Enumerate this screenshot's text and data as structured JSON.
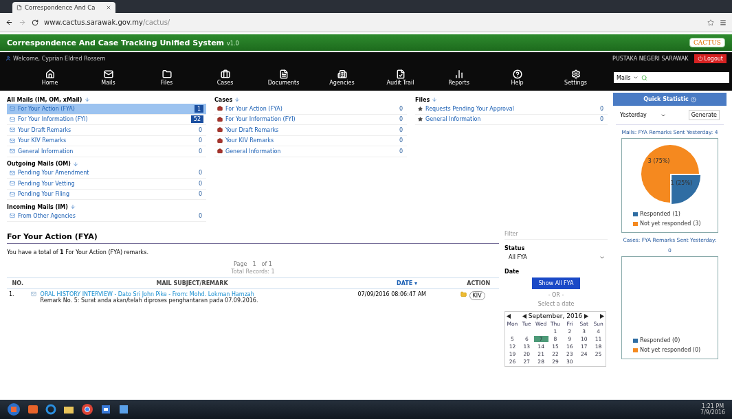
{
  "browser": {
    "tab_title": "Correspondence And Ca",
    "url_host": "www.cactus.sarawak.gov.my",
    "url_path": "/cactus/"
  },
  "header": {
    "title": "Correspondence And Case Tracking Unified System",
    "version": "v1.0",
    "logo": "CACTUS"
  },
  "userbar": {
    "welcome": "Welcome, Cyprian Eldred Rossem",
    "organization": "PUSTAKA NEGERI SARAWAK",
    "logout": "Logout"
  },
  "nav": [
    {
      "label": "Home"
    },
    {
      "label": "Mails"
    },
    {
      "label": "Files"
    },
    {
      "label": "Cases"
    },
    {
      "label": "Documents"
    },
    {
      "label": "Agencies"
    },
    {
      "label": "Audit Trail"
    },
    {
      "label": "Reports"
    },
    {
      "label": "Help"
    },
    {
      "label": "Settings"
    }
  ],
  "search": {
    "scope": "Mails"
  },
  "columns": [
    {
      "kind": "mail",
      "sections": [
        {
          "title": "All Mails (IM, OM, xMail)",
          "items": [
            {
              "label": "For Your Action (FYA)",
              "count": "1",
              "selected": true,
              "badge": true
            },
            {
              "label": "For Your Information (FYI)",
              "count": "52",
              "selected": false,
              "badge": true
            },
            {
              "label": "Your Draft Remarks",
              "count": "0",
              "selected": false,
              "badge": false
            },
            {
              "label": "Your KIV Remarks",
              "count": "0",
              "selected": false,
              "badge": false
            },
            {
              "label": "General Information",
              "count": "0",
              "selected": false,
              "badge": false
            }
          ]
        },
        {
          "title": "Outgoing Mails (OM)",
          "items": [
            {
              "label": "Pending Your Amendment",
              "count": "0",
              "selected": false,
              "badge": false
            },
            {
              "label": "Pending Your Vetting",
              "count": "0",
              "selected": false,
              "badge": false
            },
            {
              "label": "Pending Your Filing",
              "count": "0",
              "selected": false,
              "badge": false
            }
          ]
        },
        {
          "title": "Incoming Mails (IM)",
          "items": [
            {
              "label": "From Other Agencies",
              "count": "0",
              "selected": false,
              "badge": false
            }
          ]
        }
      ]
    },
    {
      "kind": "case",
      "sections": [
        {
          "title": "Cases",
          "items": [
            {
              "label": "For Your Action (FYA)",
              "count": "0",
              "selected": false,
              "badge": false
            },
            {
              "label": "For Your Information (FYI)",
              "count": "0",
              "selected": false,
              "badge": false
            },
            {
              "label": "Your Draft Remarks",
              "count": "0",
              "selected": false,
              "badge": false
            },
            {
              "label": "Your KIV Remarks",
              "count": "0",
              "selected": false,
              "badge": false
            },
            {
              "label": "General Information",
              "count": "0",
              "selected": false,
              "badge": false
            }
          ]
        }
      ]
    },
    {
      "kind": "file",
      "sections": [
        {
          "title": "Files",
          "items": [
            {
              "label": "Requests Pending Your Approval",
              "count": "0",
              "selected": false,
              "badge": false
            },
            {
              "label": "General Information",
              "count": "0",
              "selected": false,
              "badge": false
            }
          ]
        }
      ]
    }
  ],
  "fya": {
    "title": "For Your Action (FYA)",
    "summary": "You have a total of **1** For Your Action (FYA) remarks.",
    "pager": {
      "page_label": "Page",
      "page": "1",
      "of": "of 1",
      "total": "Total Records: 1"
    },
    "table": {
      "columns": [
        "NO.",
        "MAIL SUBJECT/REMARK",
        "DATE ▾",
        "ACTION"
      ],
      "rows": [
        {
          "no": "1.",
          "subject": "ORAL HISTORY INTERVIEW - Dato Sri John Pike - From: Mohd. Lokman Hamzah",
          "remark": "Remark No. 5: Surat anda akan/telah diproses penghantaran pada 07.09.2016.",
          "date": "07/09/2016 08:06:47 AM",
          "action": "KIV"
        }
      ]
    }
  },
  "filter": {
    "label": "Filter",
    "status_label": "Status",
    "status_value": "All FYA",
    "date_label": "Date",
    "show_button": "Show All FYA",
    "or_text": "- OR -",
    "select_text": "Select a date",
    "calendar": {
      "month": "September, 2016",
      "weekdays": [
        "Mon",
        "Tue",
        "Wed",
        "Thu",
        "Fri",
        "Sat",
        "Sun"
      ],
      "weeks": [
        [
          {
            "kind": "blank"
          },
          {
            "kind": "blank"
          },
          {
            "kind": "blank"
          },
          {
            "kind": "day",
            "label": "1",
            "selected": false
          },
          {
            "kind": "day",
            "label": "2",
            "selected": false
          },
          {
            "kind": "day",
            "label": "3",
            "selected": false
          },
          {
            "kind": "day",
            "label": "4",
            "selected": false
          }
        ],
        [
          {
            "kind": "day",
            "label": "5",
            "selected": false
          },
          {
            "kind": "day",
            "label": "6",
            "selected": false
          },
          {
            "kind": "day",
            "label": "7",
            "selected": true
          },
          {
            "kind": "day",
            "label": "8",
            "selected": false
          },
          {
            "kind": "day",
            "label": "9",
            "selected": false
          },
          {
            "kind": "day",
            "label": "10",
            "selected": false
          },
          {
            "kind": "day",
            "label": "11",
            "selected": false
          }
        ],
        [
          {
            "kind": "day",
            "label": "12",
            "selected": false
          },
          {
            "kind": "day",
            "label": "13",
            "selected": false
          },
          {
            "kind": "day",
            "label": "14",
            "selected": false
          },
          {
            "kind": "day",
            "label": "15",
            "selected": false
          },
          {
            "kind": "day",
            "label": "16",
            "selected": false
          },
          {
            "kind": "day",
            "label": "17",
            "selected": false
          },
          {
            "kind": "day",
            "label": "18",
            "selected": false
          }
        ],
        [
          {
            "kind": "day",
            "label": "19",
            "selected": false
          },
          {
            "kind": "day",
            "label": "20",
            "selected": false
          },
          {
            "kind": "day",
            "label": "21",
            "selected": false
          },
          {
            "kind": "day",
            "label": "22",
            "selected": false
          },
          {
            "kind": "day",
            "label": "23",
            "selected": false
          },
          {
            "kind": "day",
            "label": "24",
            "selected": false
          },
          {
            "kind": "day",
            "label": "25",
            "selected": false
          }
        ],
        [
          {
            "kind": "day",
            "label": "26",
            "selected": false
          },
          {
            "kind": "day",
            "label": "27",
            "selected": false
          },
          {
            "kind": "day",
            "label": "28",
            "selected": false
          },
          {
            "kind": "day",
            "label": "29",
            "selected": false
          },
          {
            "kind": "day",
            "label": "30",
            "selected": false
          }
        ]
      ]
    }
  },
  "stats": {
    "title": "Quick Statistic",
    "period": "Yesterday",
    "generate": "Generate",
    "panels": [
      {
        "kind": "pie",
        "caption": "Mails: FYA Remarks Sent Yesterday: 4",
        "chart_data": {
          "type": "pie",
          "categories": [
            "Responded",
            "Not yet responded"
          ],
          "series": [
            {
              "values": [
                25,
                75
              ]
            }
          ],
          "colors": [
            "#2f6da3",
            "#f5891f"
          ],
          "value_labels": [
            "1 (25%)",
            "3 (75%)"
          ]
        },
        "legend_counts": [
          "(1)",
          "(3)"
        ]
      },
      {
        "kind": "empty",
        "caption": "Cases: FYA Remarks Sent Yesterday:",
        "total": "0",
        "legend": [
          {
            "label": "Responded (0)",
            "color": "#2f6da3"
          },
          {
            "label": "Not yet responded (0)",
            "color": "#f5891f"
          }
        ]
      }
    ]
  },
  "taskbar": {
    "time": "1:21 PM",
    "date": "7/9/2016"
  }
}
